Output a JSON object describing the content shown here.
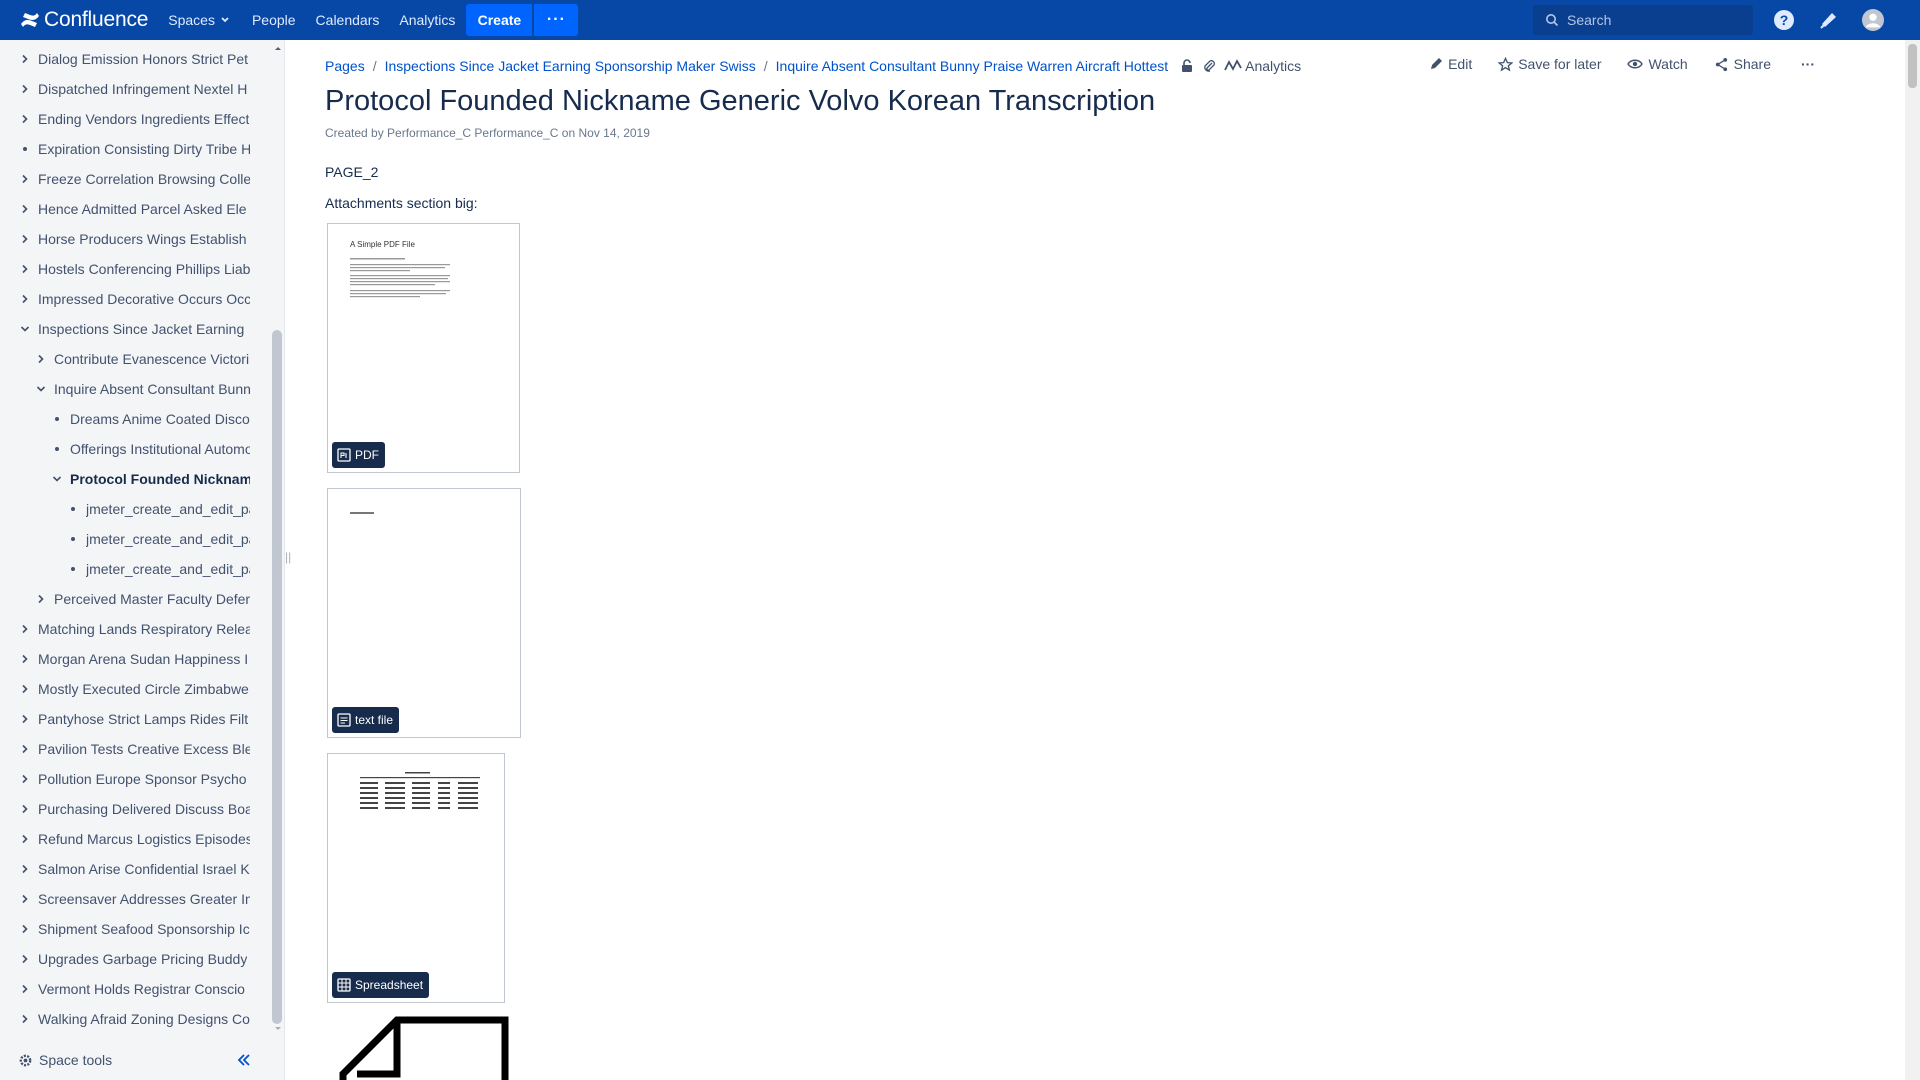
{
  "topnav": {
    "logo_text": "Confluence",
    "spaces": "Spaces",
    "people": "People",
    "calendars": "Calendars",
    "analytics": "Analytics",
    "create": "Create",
    "more": "···",
    "search_placeholder": "Search",
    "icons": [
      "help-icon",
      "notifications-icon",
      "user-avatar-icon"
    ],
    "brand_color": "#0747a6",
    "create_color": "#0065ff"
  },
  "sidebar": {
    "items": [
      {
        "label": "Dialog Emission Honors Strict Pet",
        "level": 0,
        "toggle": "collapsed"
      },
      {
        "label": "Dispatched Infringement Nextel H",
        "level": 0,
        "toggle": "collapsed"
      },
      {
        "label": "Ending Vendors Ingredients Effect",
        "level": 0,
        "toggle": "collapsed"
      },
      {
        "label": "Expiration Consisting Dirty Tribe H",
        "level": 0,
        "toggle": "leaf"
      },
      {
        "label": "Freeze Correlation Browsing Colle",
        "level": 0,
        "toggle": "collapsed"
      },
      {
        "label": "Hence Admitted Parcel Asked Ele",
        "level": 0,
        "toggle": "collapsed"
      },
      {
        "label": "Horse Producers Wings Establish",
        "level": 0,
        "toggle": "collapsed"
      },
      {
        "label": "Hostels Conferencing Phillips Liab",
        "level": 0,
        "toggle": "collapsed"
      },
      {
        "label": "Impressed Decorative Occurs Occ",
        "level": 0,
        "toggle": "collapsed"
      },
      {
        "label": "Inspections Since Jacket Earning",
        "level": 0,
        "toggle": "expanded"
      },
      {
        "label": "Contribute Evanescence Victori",
        "level": 1,
        "toggle": "collapsed"
      },
      {
        "label": "Inquire Absent Consultant Bunn",
        "level": 1,
        "toggle": "expanded"
      },
      {
        "label": "Dreams Anime Coated Disco",
        "level": 2,
        "toggle": "leaf"
      },
      {
        "label": "Offerings Institutional Automo",
        "level": 2,
        "toggle": "leaf"
      },
      {
        "label": "Protocol Founded Nicknam",
        "level": 2,
        "toggle": "expanded",
        "current": true
      },
      {
        "label": "jmeter_create_and_edit_pa",
        "level": 3,
        "toggle": "leaf"
      },
      {
        "label": "jmeter_create_and_edit_pa",
        "level": 3,
        "toggle": "leaf"
      },
      {
        "label": "jmeter_create_and_edit_pa",
        "level": 3,
        "toggle": "leaf"
      },
      {
        "label": "Perceived Master Faculty Defer",
        "level": 1,
        "toggle": "collapsed"
      },
      {
        "label": "Matching Lands Respiratory Relea",
        "level": 0,
        "toggle": "collapsed"
      },
      {
        "label": "Morgan Arena Sudan Happiness I",
        "level": 0,
        "toggle": "collapsed"
      },
      {
        "label": "Mostly Executed Circle Zimbabwe",
        "level": 0,
        "toggle": "collapsed"
      },
      {
        "label": "Pantyhose Strict Lamps Rides Filt",
        "level": 0,
        "toggle": "collapsed"
      },
      {
        "label": "Pavilion Tests Creative Excess Ble",
        "level": 0,
        "toggle": "collapsed"
      },
      {
        "label": "Pollution Europe Sponsor Psycho",
        "level": 0,
        "toggle": "collapsed"
      },
      {
        "label": "Purchasing Delivered Discuss Boa",
        "level": 0,
        "toggle": "collapsed"
      },
      {
        "label": "Refund Marcus Logistics Episodes",
        "level": 0,
        "toggle": "collapsed"
      },
      {
        "label": "Salmon Arise Confidential Israel K",
        "level": 0,
        "toggle": "collapsed"
      },
      {
        "label": "Screensaver Addresses Greater In",
        "level": 0,
        "toggle": "collapsed"
      },
      {
        "label": "Shipment Seafood Sponsorship Ic",
        "level": 0,
        "toggle": "collapsed"
      },
      {
        "label": "Upgrades Garbage Pricing Buddy",
        "level": 0,
        "toggle": "collapsed"
      },
      {
        "label": "Vermont Holds Registrar Conscio",
        "level": 0,
        "toggle": "collapsed"
      },
      {
        "label": "Walking Afraid Zoning Designs Co",
        "level": 0,
        "toggle": "collapsed"
      }
    ],
    "space_tools": "Space tools"
  },
  "breadcrumb": {
    "items": [
      "Pages",
      "Inspections Since Jacket Earning Sponsorship Maker Swiss",
      "Inquire Absent Consultant Bunny Praise Warren Aircraft Hottest"
    ],
    "separator": "/",
    "analytics": "Analytics"
  },
  "actions": {
    "edit": "Edit",
    "save_for_later": "Save for later",
    "watch": "Watch",
    "share": "Share",
    "more": "···"
  },
  "page": {
    "title": "Protocol Founded Nickname Generic Volvo Korean Transcription",
    "byline_prefix": "Created by",
    "author": "Performance_C Performance_C",
    "byline_on": "on",
    "date": "Nov 14, 2019",
    "body_line1": "PAGE_2",
    "body_line2": "Attachments section big:"
  },
  "attachments": [
    {
      "type": "PDF",
      "icon": "pdf-icon",
      "preview_title": "A Simple PDF File"
    },
    {
      "type": "text file",
      "icon": "text-file-icon"
    },
    {
      "type": "Spreadsheet",
      "icon": "spreadsheet-icon"
    }
  ]
}
